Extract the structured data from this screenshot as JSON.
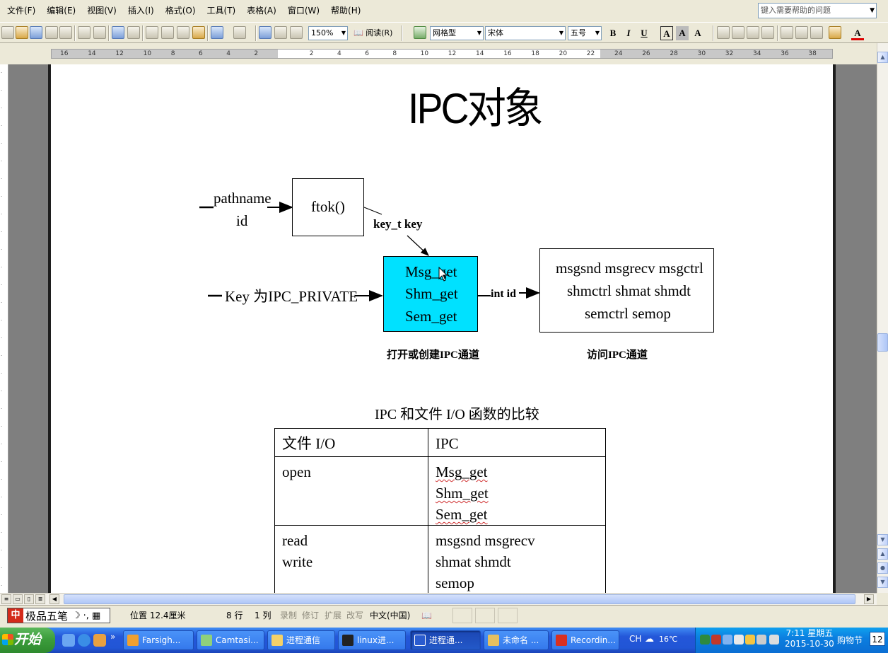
{
  "menu": [
    "文件(F)",
    "编辑(E)",
    "视图(V)",
    "插入(I)",
    "格式(O)",
    "工具(T)",
    "表格(A)",
    "窗口(W)",
    "帮助(H)"
  ],
  "help_placeholder": "键入需要帮助的问题",
  "toolbar": {
    "zoom": "150%",
    "read_label": "阅读(R)",
    "style": "网格型",
    "font": "宋体",
    "size": "五号"
  },
  "ruler_ticks": [
    "16",
    "14",
    "12",
    "10",
    "8",
    "6",
    "4",
    "2",
    "",
    "2",
    "4",
    "6",
    "8",
    "10",
    "12",
    "14",
    "16",
    "18",
    "20",
    "22",
    "24",
    "26",
    "28",
    "30",
    "32",
    "34",
    "36",
    "38"
  ],
  "document": {
    "title": "IPC对象",
    "diagram": {
      "input1_line1": "pathname",
      "input1_line2": "id",
      "ftok": "ftok()",
      "key_label": "key_t key",
      "input2": "Key 为IPC_PRIVATE",
      "get_lines": [
        "Msg_get",
        "Shm_get",
        "Sem_get"
      ],
      "int_id": "int id",
      "access_lines": [
        "msgsnd msgrecv msgctrl",
        "shmctrl shmat shmdt",
        "semctrl semop"
      ],
      "caption_left": "打开或创建IPC通道",
      "caption_right": "访问IPC通道"
    },
    "table_caption": "IPC 和文件 I/O 函数的比较",
    "table": {
      "headers": [
        "文件 I/O",
        "IPC"
      ],
      "rows": [
        {
          "file": [
            "open"
          ],
          "ipc": [
            "Msg_get",
            "Shm_get",
            "Sem_get"
          ]
        },
        {
          "file": [
            "read",
            "write"
          ],
          "ipc": [
            "msgsnd msgrecv",
            "shmat shmdt",
            "semop"
          ]
        }
      ]
    }
  },
  "status": {
    "ime": "极品五笔",
    "position": "位置 12.4厘米",
    "line": "8 行",
    "col": "1 列",
    "rec": "录制",
    "trk": "修订",
    "ext": "扩展",
    "ovr": "改写",
    "lang": "中文(中国)"
  },
  "taskbar": {
    "start": "开始",
    "tasks": [
      "Farsigh...",
      "Camtasi...",
      "进程通信",
      "linux进...",
      "进程通...",
      "未命名 ...",
      "Recordin..."
    ],
    "lang": "CH",
    "weather": "16℃",
    "time": "7:11 星期五",
    "date": "2015-10-30",
    "promo": "购物节",
    "promo_day": "12"
  }
}
